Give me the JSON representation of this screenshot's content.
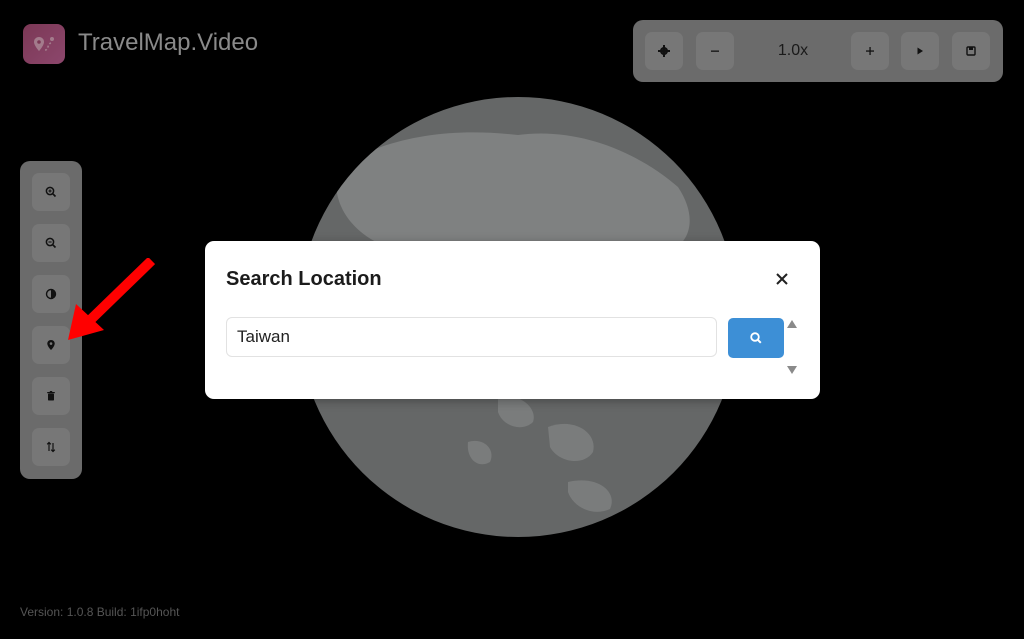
{
  "header": {
    "app_title": "TravelMap.Video"
  },
  "toolbar": {
    "zoom_level": "1.0x",
    "buttons": [
      {
        "icon": "gear-icon"
      },
      {
        "icon": "minus-icon"
      },
      {
        "icon": "plus-icon"
      },
      {
        "icon": "play-icon"
      },
      {
        "icon": "save-icon"
      }
    ]
  },
  "sidebar": {
    "items": [
      {
        "icon": "zoom-in-icon"
      },
      {
        "icon": "zoom-out-icon"
      },
      {
        "icon": "theme-icon"
      },
      {
        "icon": "location-pin-icon"
      },
      {
        "icon": "delete-icon"
      },
      {
        "icon": "sort-icon"
      }
    ]
  },
  "modal": {
    "title": "Search Location",
    "search_value": "Taiwan"
  },
  "footer": {
    "version": "Version: 1.0.8 Build: 1ifp0hoht"
  },
  "colors": {
    "accent": "#3d8fd6",
    "annotation_arrow": "#ff0000"
  }
}
